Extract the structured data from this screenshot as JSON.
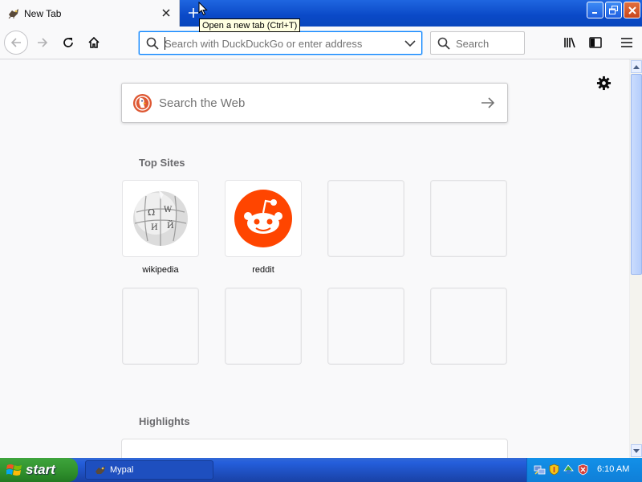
{
  "window": {
    "tab_title": "New Tab",
    "tooltip": "Open a new tab (Ctrl+T)"
  },
  "toolbar": {
    "url_placeholder": "Search with DuckDuckGo or enter address",
    "search_placeholder": "Search"
  },
  "newtab": {
    "web_search_placeholder": "Search the Web",
    "top_sites_title": "Top Sites",
    "highlights_title": "Highlights",
    "top_sites": [
      {
        "label": "wikipedia",
        "icon": "wikipedia-globe-icon"
      },
      {
        "label": "reddit",
        "icon": "reddit-alien-icon"
      }
    ]
  },
  "taskbar": {
    "start_label": "start",
    "task_label": "Mypal",
    "clock": "6:10 AM"
  },
  "colors": {
    "accent": "#0a84ff",
    "reddit": "#ff4500",
    "ddg": "#de5833",
    "xp_blue": "#245edb",
    "xp_green": "#3ea43c"
  }
}
